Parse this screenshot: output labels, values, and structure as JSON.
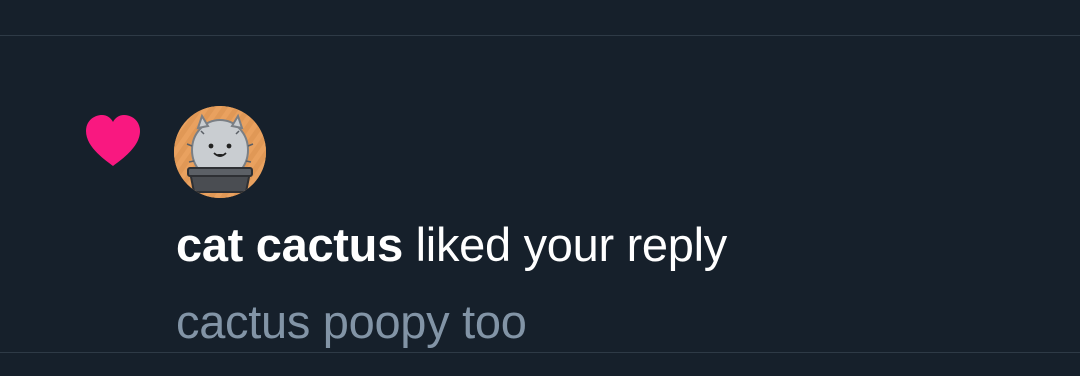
{
  "notification": {
    "type_icon": "heart-icon",
    "avatar_icon": "cat-cactus-avatar",
    "actor_name": "cat cactus",
    "action_text": " liked your reply",
    "reply_text": "cactus poopy too"
  },
  "colors": {
    "background": "#16202b",
    "divider": "#2e3a46",
    "heart": "#f91880",
    "headline": "#ffffff",
    "secondary_text": "#8294a6"
  }
}
